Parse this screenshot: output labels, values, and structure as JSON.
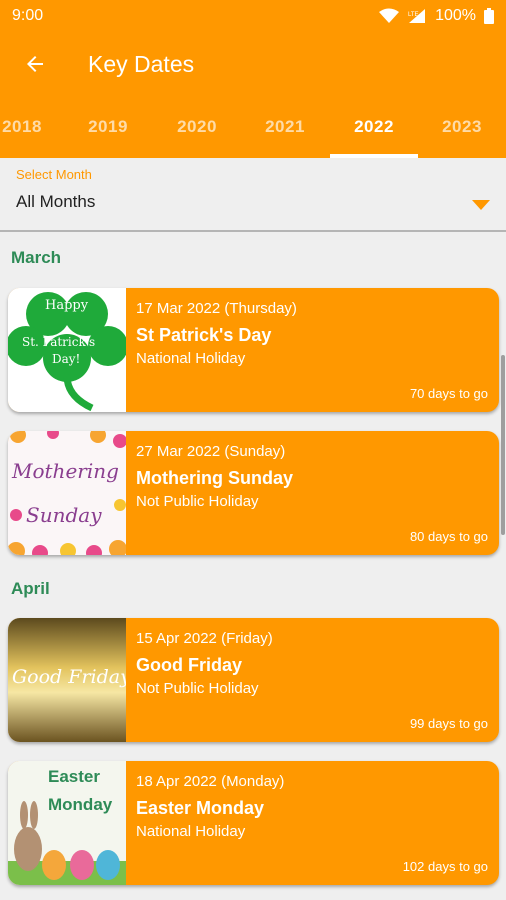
{
  "status": {
    "time": "9:00",
    "battery": "100%"
  },
  "appbar": {
    "title": "Key Dates"
  },
  "tabs": [
    {
      "label": "2018"
    },
    {
      "label": "2019"
    },
    {
      "label": "2020"
    },
    {
      "label": "2021"
    },
    {
      "label": "2022"
    },
    {
      "label": "2023"
    }
  ],
  "selected_tab": "2022",
  "month_select": {
    "label": "Select Month",
    "value": "All Months"
  },
  "sections": [
    {
      "month": "March",
      "events": [
        {
          "date": "17 Mar 2022 (Thursday)",
          "title": "St Patrick's Day",
          "type": "National Holiday",
          "countdown": "70 days to go",
          "image_text": [
            "Happy",
            "St. Patrick's",
            "Day!"
          ]
        },
        {
          "date": "27 Mar 2022 (Sunday)",
          "title": "Mothering Sunday",
          "type": "Not Public Holiday",
          "countdown": "80 days to go",
          "image_text": [
            "Mothering",
            "Sunday"
          ]
        }
      ]
    },
    {
      "month": "April",
      "events": [
        {
          "date": "15 Apr 2022 (Friday)",
          "title": "Good Friday",
          "type": "Not Public Holiday",
          "countdown": "99 days to go",
          "image_text": [
            "Good Friday"
          ]
        },
        {
          "date": "18 Apr 2022 (Monday)",
          "title": "Easter Monday",
          "type": "National Holiday",
          "countdown": "102 days to go",
          "image_text": [
            "Easter",
            "Monday"
          ]
        }
      ]
    }
  ],
  "colors": {
    "accent": "#ff9800",
    "month_header": "#2e8b57",
    "background": "#efefef"
  }
}
